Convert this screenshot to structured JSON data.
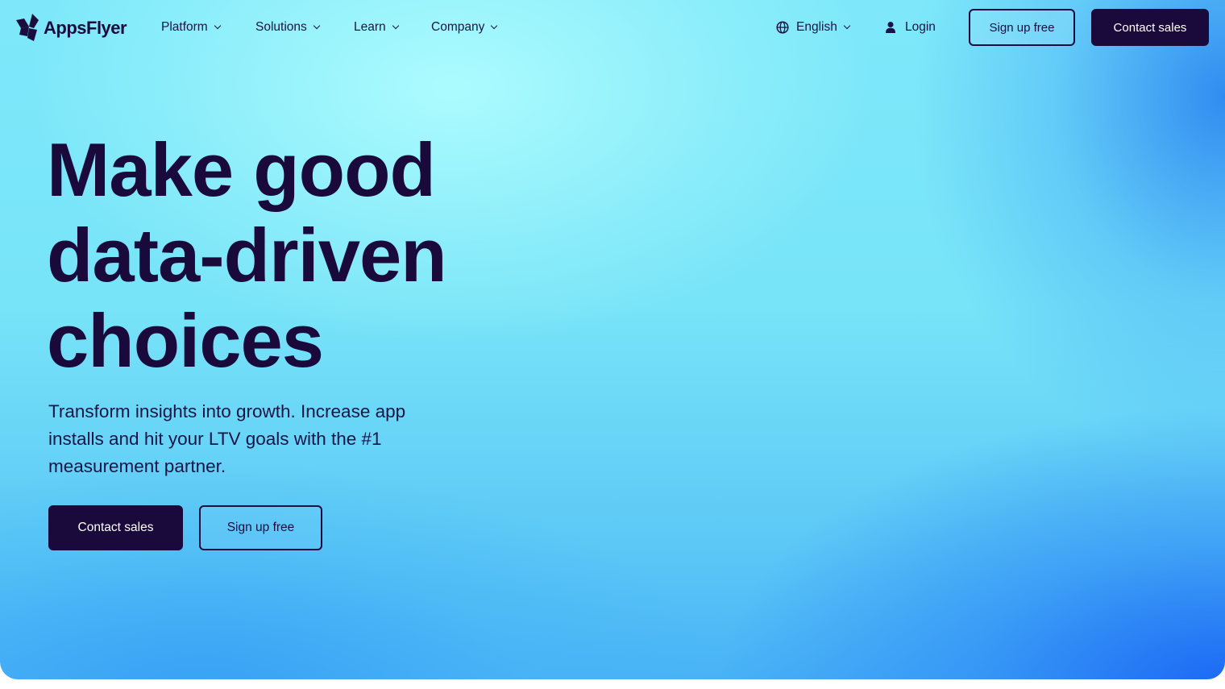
{
  "brand": {
    "name": "AppsFlyer",
    "logo_icon": "appsflyer-logo-icon"
  },
  "nav": {
    "items": [
      {
        "label": "Platform",
        "icon": "chevron-down-icon"
      },
      {
        "label": "Solutions",
        "icon": "chevron-down-icon"
      },
      {
        "label": "Learn",
        "icon": "chevron-down-icon"
      },
      {
        "label": "Company",
        "icon": "chevron-down-icon"
      }
    ],
    "language": {
      "label": "English",
      "icon": "globe-icon",
      "caret": "chevron-down-icon"
    },
    "login": {
      "label": "Login",
      "icon": "user-icon"
    },
    "signup_label": "Sign up free",
    "contact_label": "Contact sales"
  },
  "hero": {
    "headline_lines": [
      "Make good",
      "data-driven",
      "choices"
    ],
    "subhead": "Transform insights into growth. Increase app installs and hit your LTV goals with the #1 measurement partner.",
    "primary_cta": "Contact sales",
    "secondary_cta": "Sign up free"
  },
  "colors": {
    "text_dark": "#190a3b",
    "button_dark": "#190a3b",
    "bg_light_cyan": "#a6f8fb",
    "bg_cyan": "#6fe0f7",
    "bg_blue": "#3ea8f5",
    "bg_deep_blue": "#1e6ff5"
  }
}
